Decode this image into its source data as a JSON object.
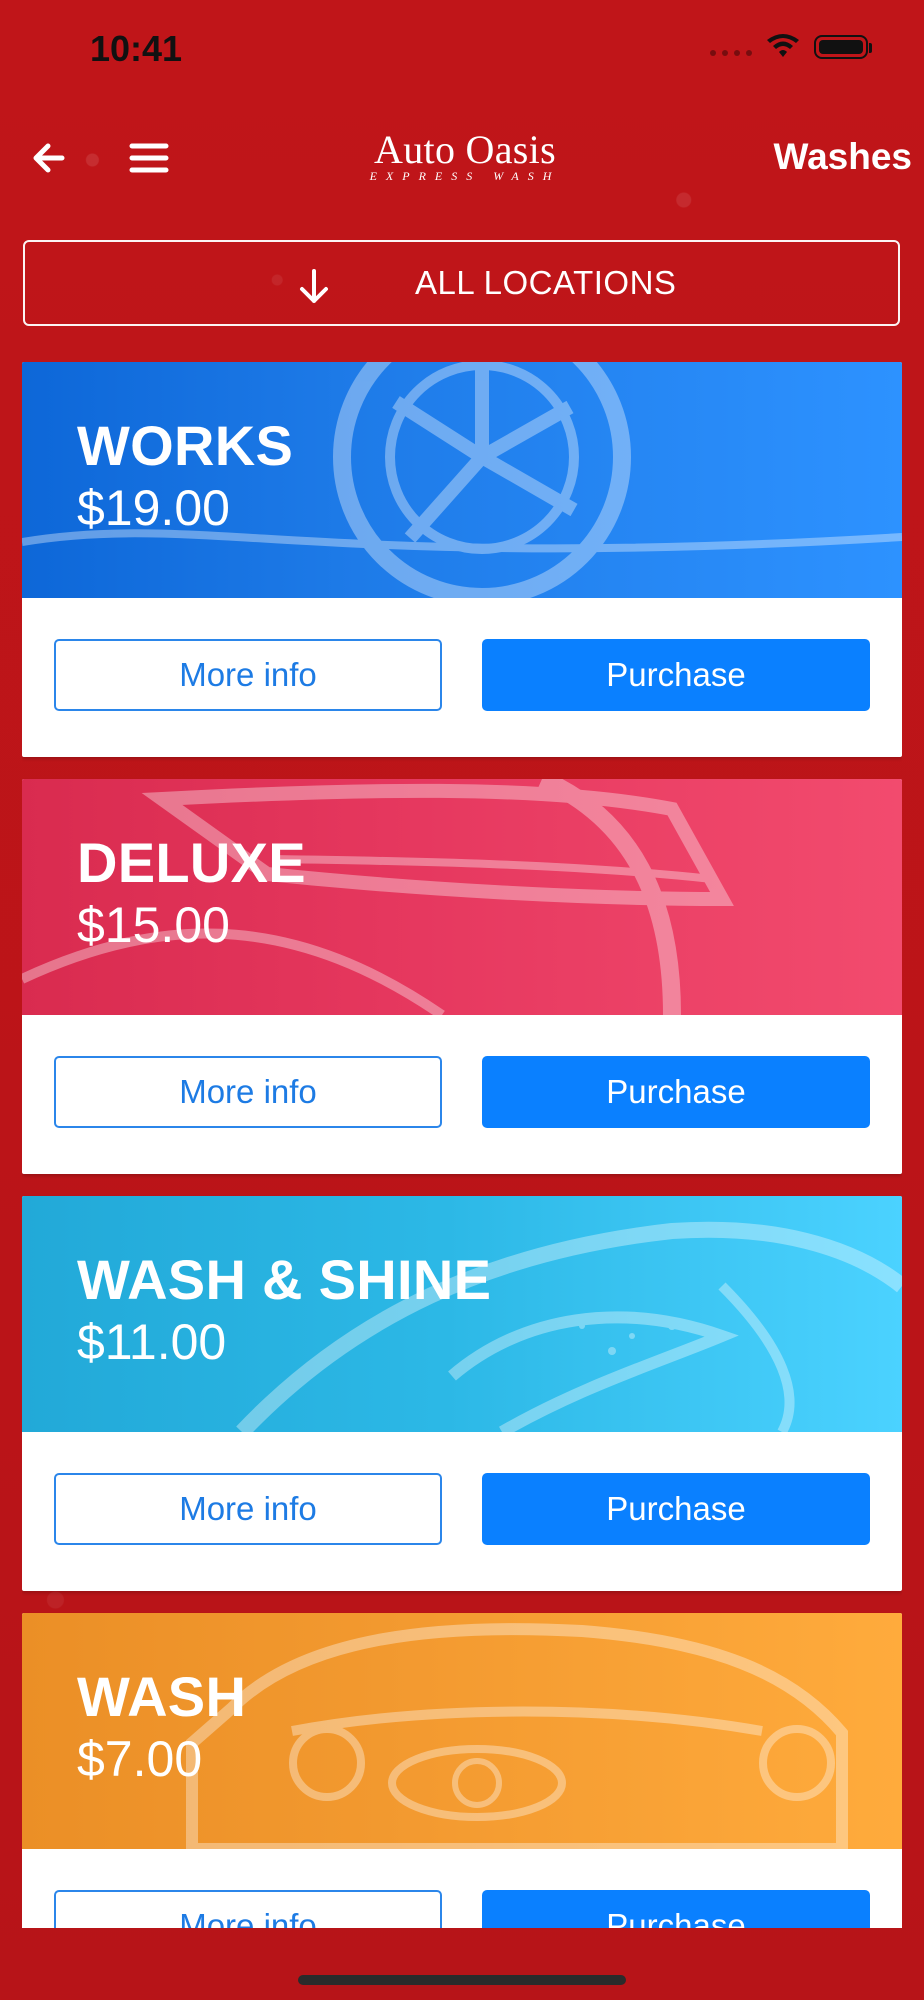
{
  "status_bar": {
    "time": "10:41",
    "icons": [
      "cellular-signal-icon",
      "wifi-icon",
      "battery-icon"
    ]
  },
  "nav": {
    "back_icon": "arrow-left-icon",
    "menu_icon": "hamburger-menu-icon",
    "brand_name": "Auto Oasis",
    "brand_subtitle": "EXPRESS WASH",
    "title": "Washes"
  },
  "location_filter": {
    "icon": "arrow-down-icon",
    "label": "ALL LOCATIONS"
  },
  "colors": {
    "background": "#bd151a",
    "primary_button": "#0a80ff",
    "outline_button": "#2b86ea",
    "works_card": "#1478ee",
    "deluxe_card": "#eb4368",
    "wash_shine_card": "#2fb8e6",
    "wash_card": "#f49c32"
  },
  "cards": [
    {
      "title": "WORKS",
      "price": "$19.00",
      "more_info_label": "More info",
      "purchase_label": "Purchase"
    },
    {
      "title": "DELUXE",
      "price": "$15.00",
      "more_info_label": "More info",
      "purchase_label": "Purchase"
    },
    {
      "title": "WASH & SHINE",
      "price": "$11.00",
      "more_info_label": "More info",
      "purchase_label": "Purchase"
    },
    {
      "title": "WASH",
      "price": "$7.00",
      "more_info_label": "More info",
      "purchase_label": "Purchase"
    }
  ]
}
